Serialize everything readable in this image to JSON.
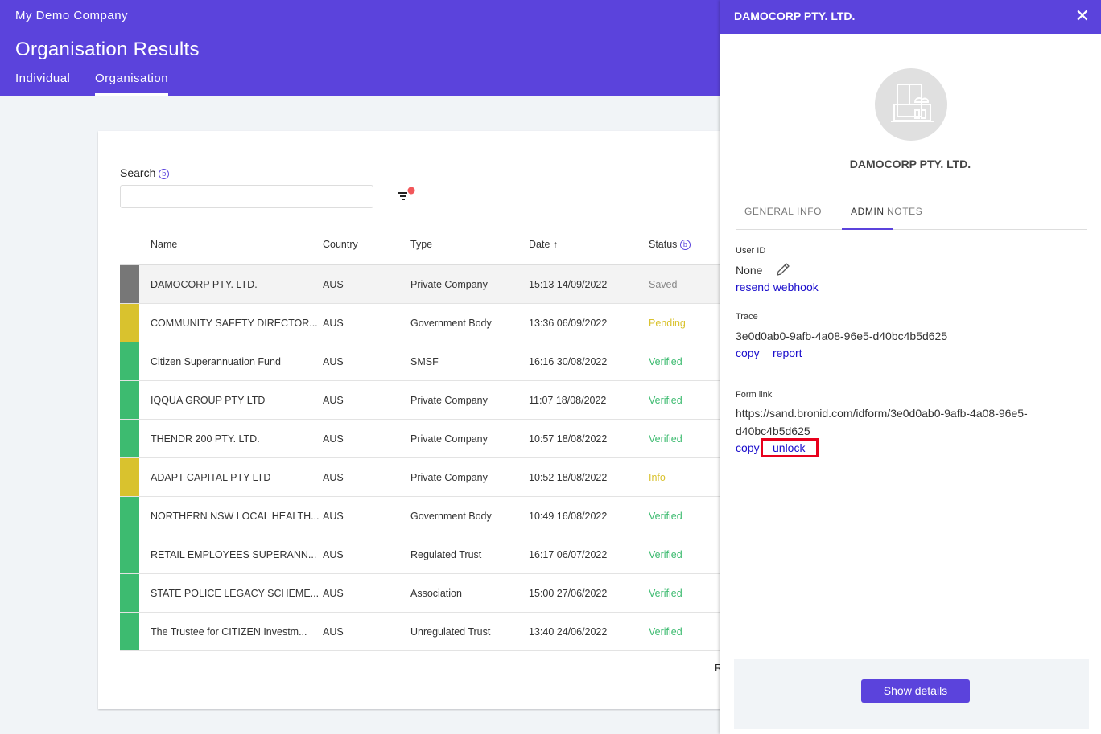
{
  "header": {
    "company": "My Demo Company",
    "title": "Organisation Results",
    "tabs": [
      "Individual",
      "Organisation"
    ]
  },
  "search": {
    "label": "Search",
    "value": "",
    "placeholder": ""
  },
  "table": {
    "columns": [
      "Name",
      "Country",
      "Type",
      "Date",
      "Status"
    ],
    "rows": [
      {
        "name": "DAMOCORP PTY. LTD.",
        "country": "AUS",
        "type": "Private Company",
        "date": "15:13 14/09/2022",
        "status": "Saved",
        "color": "#777777"
      },
      {
        "name": "COMMUNITY SAFETY DIRECTOR...",
        "country": "AUS",
        "type": "Government Body",
        "date": "13:36 06/09/2022",
        "status": "Pending",
        "color": "#d9c22e"
      },
      {
        "name": "Citizen Superannuation Fund",
        "country": "AUS",
        "type": "SMSF",
        "date": "16:16 30/08/2022",
        "status": "Verified",
        "color": "#3dbb70"
      },
      {
        "name": "IQQUA GROUP PTY LTD",
        "country": "AUS",
        "type": "Private Company",
        "date": "11:07 18/08/2022",
        "status": "Verified",
        "color": "#3dbb70"
      },
      {
        "name": "THENDR 200 PTY. LTD.",
        "country": "AUS",
        "type": "Private Company",
        "date": "10:57 18/08/2022",
        "status": "Verified",
        "color": "#3dbb70"
      },
      {
        "name": "ADAPT CAPITAL PTY LTD",
        "country": "AUS",
        "type": "Private Company",
        "date": "10:52 18/08/2022",
        "status": "Info",
        "color": "#d9c22e"
      },
      {
        "name": "NORTHERN NSW LOCAL HEALTH...",
        "country": "AUS",
        "type": "Government Body",
        "date": "10:49 16/08/2022",
        "status": "Verified",
        "color": "#3dbb70"
      },
      {
        "name": "RETAIL EMPLOYEES SUPERANN...",
        "country": "AUS",
        "type": "Regulated Trust",
        "date": "16:17 06/07/2022",
        "status": "Verified",
        "color": "#3dbb70"
      },
      {
        "name": "STATE POLICE LEGACY SCHEME...",
        "country": "AUS",
        "type": "Association",
        "date": "15:00 27/06/2022",
        "status": "Verified",
        "color": "#3dbb70"
      },
      {
        "name": "The Trustee for CITIZEN Investm...",
        "country": "AUS",
        "type": "Unregulated Trust",
        "date": "13:40 24/06/2022",
        "status": "Verified",
        "color": "#3dbb70"
      }
    ],
    "footer_partial": "R"
  },
  "panel": {
    "title": "DAMOCORP PTY. LTD.",
    "name": "DAMOCORP PTY. LTD.",
    "tabs": [
      "GENERAL INFO",
      "ADMIN",
      "NOTES"
    ],
    "user_id_label": "User ID",
    "user_id": "None",
    "resend": "resend webhook",
    "trace_label": "Trace",
    "trace": "3e0d0ab0-9afb-4a08-96e5-d40bc4b5d625",
    "copy": "copy",
    "report": "report",
    "form_label": "Form link",
    "form_link_1": "https://sand.bronid.com/idform/3e0d0ab0-9afb-4a08-96e5-",
    "form_link_2": "d40bc4b5d625",
    "unlock": "unlock",
    "show_details": "Show details"
  }
}
